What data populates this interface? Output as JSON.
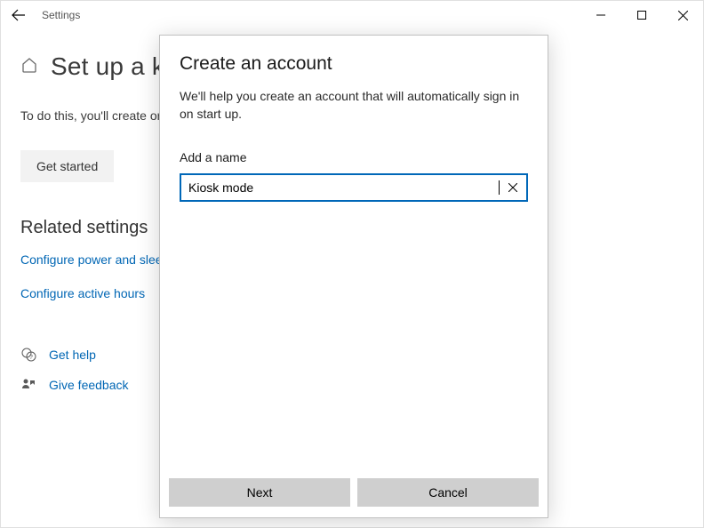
{
  "titlebar": {
    "title": "Settings"
  },
  "page": {
    "title": "Set up a kiosk",
    "description": "To do this, you'll create or choose an account and specify the only app that it can use (sign in will be automatic).",
    "get_started": "Get started"
  },
  "related": {
    "heading": "Related settings",
    "links": [
      "Configure power and sleep settings",
      "Configure active hours"
    ]
  },
  "help": {
    "get_help": "Get help",
    "give_feedback": "Give feedback"
  },
  "dialog": {
    "title": "Create an account",
    "description": "We'll help you create an account that will automatically sign in on start up.",
    "field_label": "Add a name",
    "input_value": "Kiosk mode",
    "next": "Next",
    "cancel": "Cancel"
  }
}
